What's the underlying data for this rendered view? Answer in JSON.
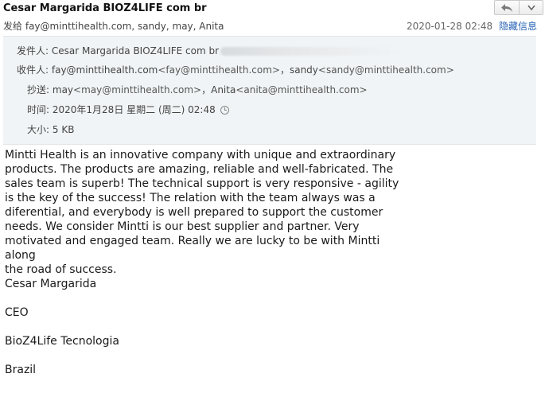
{
  "subject": "Cesar Margarida BIOZ4LIFE com br",
  "sender_summary": {
    "label": "发给",
    "recipients": "fay@minttihealth.com, sandy, may, Anita"
  },
  "date_short": "2020-01-28 02:48",
  "hide_info_label": "隐藏信息",
  "toolbar": {
    "reply_icon": "reply-arrow-icon",
    "dropdown_icon": "chevron-down-icon"
  },
  "details": {
    "from_label": "发件人:",
    "from_value": "Cesar Margarida BIOZ4LIFE com br",
    "to_label": "收件人:",
    "to_1_name": "fay@minttihealth.com",
    "to_1_addr": "<fay@minttihealth.com>",
    "to_sep": "，",
    "to_2_name": "sandy",
    "to_2_addr": "<sandy@minttihealth.com>",
    "cc_label": "抄送:",
    "cc_1_name": "may",
    "cc_1_addr": "<may@minttihealth.com>",
    "cc_sep": "，",
    "cc_2_name": "Anita",
    "cc_2_addr": "<anita@minttihealth.com>",
    "time_label": "时间:",
    "time_value": "2020年1月28日 星期二 (周二) 02:48",
    "size_label": "大小:",
    "size_value": "5 KB"
  },
  "body": "Mintti Health is an innovative company with unique and extraordinary\nproducts. The products are amazing, reliable and well-fabricated. The\nsales team is superb! The technical support is very responsive - agility\nis the key of the success! The relation with the team always was a\ndiferential, and everybody is well prepared to support the customer\nneeds. We consider Mintti is our best supplier and partner. Very\nmotivated and engaged team. Really we are lucky to be with Mintti along\nthe road of success.",
  "signature": {
    "name": "Cesar Margarida",
    "title": "CEO",
    "company": "BioZ4Life Tecnologia",
    "country": "Brazil"
  }
}
